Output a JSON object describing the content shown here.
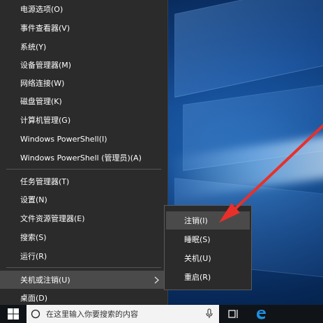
{
  "menu": {
    "items": [
      {
        "label": "电源选项(O)"
      },
      {
        "label": "事件查看器(V)"
      },
      {
        "label": "系统(Y)"
      },
      {
        "label": "设备管理器(M)"
      },
      {
        "label": "网络连接(W)"
      },
      {
        "label": "磁盘管理(K)"
      },
      {
        "label": "计算机管理(G)"
      },
      {
        "label": "Windows PowerShell(I)"
      },
      {
        "label": "Windows PowerShell (管理员)(A)"
      },
      {
        "label": "任务管理器(T)"
      },
      {
        "label": "设置(N)"
      },
      {
        "label": "文件资源管理器(E)"
      },
      {
        "label": "搜索(S)"
      },
      {
        "label": "运行(R)"
      },
      {
        "label": "关机或注销(U)"
      },
      {
        "label": "桌面(D)"
      }
    ],
    "highlighted": "关机或注销(U)"
  },
  "submenu": {
    "items": [
      {
        "label": "注销(I)"
      },
      {
        "label": "睡眠(S)"
      },
      {
        "label": "关机(U)"
      },
      {
        "label": "重启(R)"
      }
    ],
    "highlighted": "注销(I)"
  },
  "taskbar": {
    "search_placeholder": "在这里输入你要搜索的内容",
    "icons": [
      "windows-start-icon",
      "search-icon",
      "microphone-icon",
      "task-view-icon",
      "edge-browser-icon"
    ]
  },
  "colors": {
    "menu_bg": "#2b2b2b",
    "menu_highlight": "#4a4a4a",
    "annotation_arrow": "#e8302a",
    "taskbar_bg": "#101418",
    "edge_blue": "#1e8fe0"
  }
}
